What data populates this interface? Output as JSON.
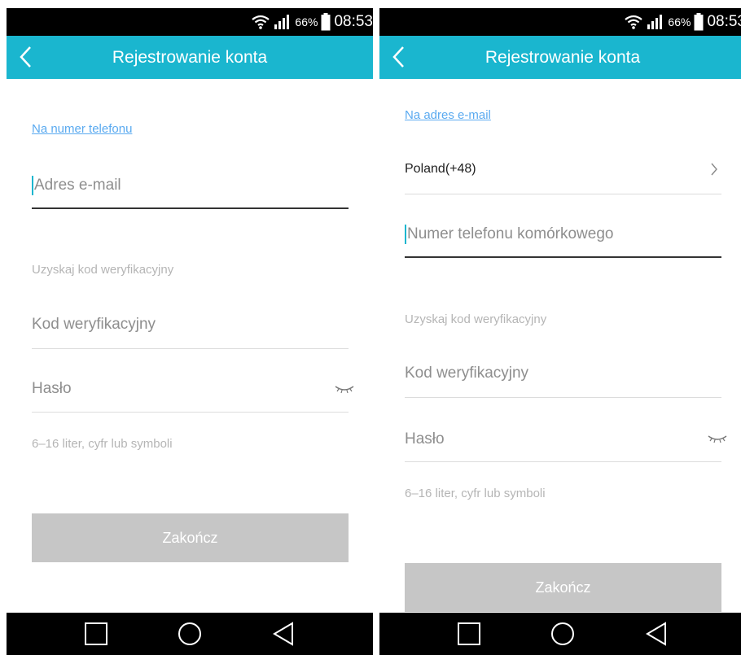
{
  "status": {
    "battery_percent": "66%",
    "time": "08:53"
  },
  "left": {
    "title": "Rejestrowanie konta",
    "switch_link": "Na numer telefonu",
    "email_placeholder": "Adres e-mail",
    "get_code": "Uzyskaj kod weryfikacyjny",
    "code_placeholder": "Kod weryfikacyjny",
    "password_placeholder": "Hasło",
    "password_hint": "6–16 liter, cyfr lub symboli",
    "finish_button": "Zakończ"
  },
  "right": {
    "title": "Rejestrowanie konta",
    "switch_link": "Na adres e-mail",
    "country": "Poland(+48)",
    "phone_placeholder": "Numer telefonu komórkowego",
    "get_code": "Uzyskaj kod weryfikacyjny",
    "code_placeholder": "Kod weryfikacyjny",
    "password_placeholder": "Hasło",
    "password_hint": "6–16 liter, cyfr lub symboli",
    "finish_button": "Zakończ"
  },
  "icons": {
    "status": [
      "wifi-icon",
      "signal-icon",
      "battery-icon"
    ],
    "appbar": [
      "back-arrow-icon"
    ],
    "fields": [
      "eye-closed-icon",
      "chevron-right-icon"
    ],
    "nav": [
      "recent-apps-icon",
      "home-icon",
      "back-icon"
    ]
  },
  "colors": {
    "accent": "#1ab6cf",
    "link": "#5aaaf0",
    "button_disabled": "#c6c6c6"
  }
}
